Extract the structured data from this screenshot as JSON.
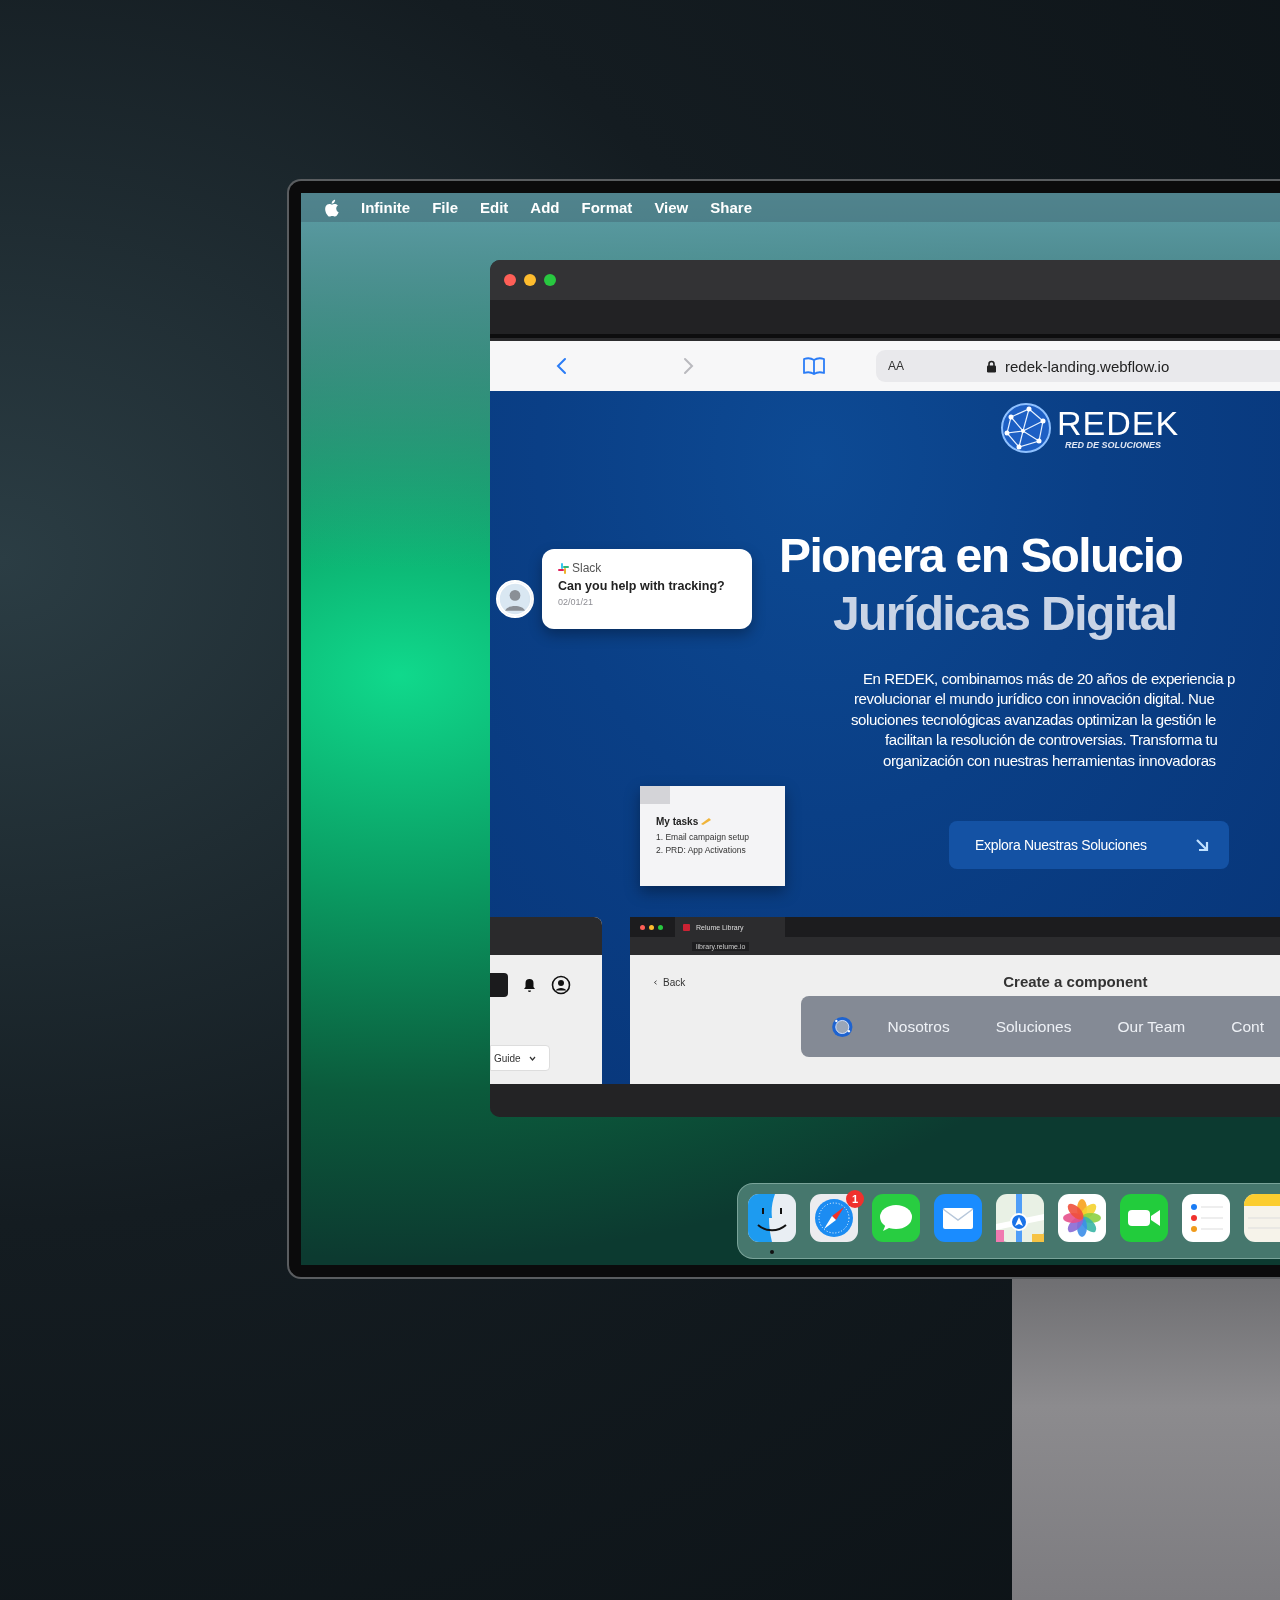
{
  "menu_bar": {
    "app": "Infinite",
    "items": [
      "File",
      "Edit",
      "Add",
      "Format",
      "View",
      "Share"
    ]
  },
  "browser": {
    "text_size": "AA",
    "url": "redek-landing.webflow.io"
  },
  "page": {
    "logo": {
      "name": "REDEK",
      "tagline": "RED DE SOLUCIONES"
    },
    "heading": [
      "Pionera en Solucio",
      "Jurídicas Digital"
    ],
    "paragraph": [
      "En REDEK, combinamos más de 20 años de experiencia p",
      "revolucionar el mundo jurídico con innovación digital. Nue",
      "soluciones tecnológicas avanzadas optimizan la gestión le",
      "facilitan la resolución de controversias. Transforma tu",
      "organización con nuestras herramientas innovadoras"
    ],
    "cta": "Explora Nuestras Soluciones",
    "slack_card": {
      "app": "Slack",
      "message": "Can you help with tracking?",
      "date": "02/01/21"
    },
    "tasks_note": {
      "title": "My tasks",
      "items": [
        "1. Email campaign setup",
        "2. PRD: App Activations"
      ]
    },
    "left_mockup": {
      "guide": "Guide"
    },
    "right_mockup": {
      "tab": "Relume Library",
      "url": "library.relume.io",
      "back": "Back",
      "title": "Create a component"
    },
    "nav": [
      "Nosotros",
      "Soluciones",
      "Our Team",
      "Cont"
    ]
  },
  "dock": [
    {
      "kind": "finder",
      "running": true
    },
    {
      "kind": "safari",
      "running": false,
      "badge": "1"
    },
    {
      "kind": "messages",
      "running": false
    },
    {
      "kind": "mail",
      "running": false
    },
    {
      "kind": "maps",
      "running": false
    },
    {
      "kind": "photos",
      "running": false
    },
    {
      "kind": "facetime",
      "running": false
    },
    {
      "kind": "reminders",
      "running": false
    },
    {
      "kind": "notes",
      "running": false
    }
  ]
}
